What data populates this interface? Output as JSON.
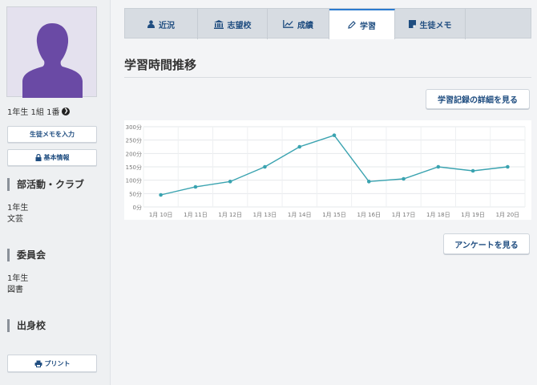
{
  "sidebar": {
    "student_id": "1年生 1組 1番",
    "memo_button": "生徒メモを入力",
    "basic_info_button": "基本情報",
    "sections": [
      {
        "title": "部活動・クラブ",
        "lines": [
          "1年生",
          "文芸"
        ]
      },
      {
        "title": "委員会",
        "lines": [
          "1年生",
          "図書"
        ]
      },
      {
        "title": "出身校",
        "lines": []
      }
    ],
    "print_button": "プリント"
  },
  "tabs": [
    {
      "label": "近況",
      "icon": "user-icon",
      "active": false
    },
    {
      "label": "志望校",
      "icon": "institution-icon",
      "active": false
    },
    {
      "label": "成績",
      "icon": "line-chart-icon",
      "active": false
    },
    {
      "label": "学習",
      "icon": "pencil-icon",
      "active": true
    },
    {
      "label": "生徒メモ",
      "icon": "note-icon",
      "active": false
    }
  ],
  "main": {
    "title": "学習時間推移",
    "details_button": "学習記録の詳細を見る",
    "survey_button": "アンケートを見る"
  },
  "colors": {
    "line": "#3aa3b0",
    "accent": "#2b7bd0",
    "link": "#1f4d80"
  },
  "chart_data": {
    "type": "line",
    "x": [
      "1月 10日",
      "1月 11日",
      "1月 12日",
      "1月 13日",
      "1月 14日",
      "1月 15日",
      "1月 16日",
      "1月 17日",
      "1月 18日",
      "1月 19日",
      "1月 20日"
    ],
    "values": [
      45,
      75,
      95,
      150,
      225,
      268,
      95,
      105,
      150,
      135,
      150
    ],
    "yticks": [
      "300分",
      "250分",
      "200分",
      "150分",
      "100分",
      "50分",
      "0分"
    ],
    "ylim": [
      0,
      300
    ],
    "grid": true
  }
}
